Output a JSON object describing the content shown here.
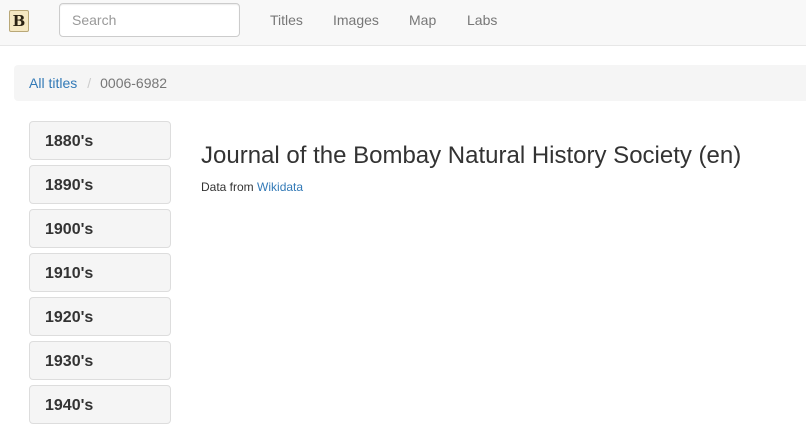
{
  "navbar": {
    "brand_letter": "B",
    "search_placeholder": "Search",
    "search_value": "",
    "links": [
      "Titles",
      "Images",
      "Map",
      "Labs"
    ]
  },
  "breadcrumb": {
    "root_label": "All titles",
    "separator": "/",
    "current": "0006-6982"
  },
  "sidebar": {
    "decades": [
      "1880's",
      "1890's",
      "1900's",
      "1910's",
      "1920's",
      "1930's",
      "1940's"
    ]
  },
  "main": {
    "title": "Journal of the Bombay Natural History Society (en)",
    "data_from_prefix": "Data from",
    "data_source_link": "Wikidata"
  },
  "colors": {
    "navbar_bg": "#f8f8f8",
    "link": "#337ab7",
    "nav_text": "#777777",
    "breadcrumb_bg": "#f5f5f5",
    "button_bg": "#f5f5f5"
  }
}
